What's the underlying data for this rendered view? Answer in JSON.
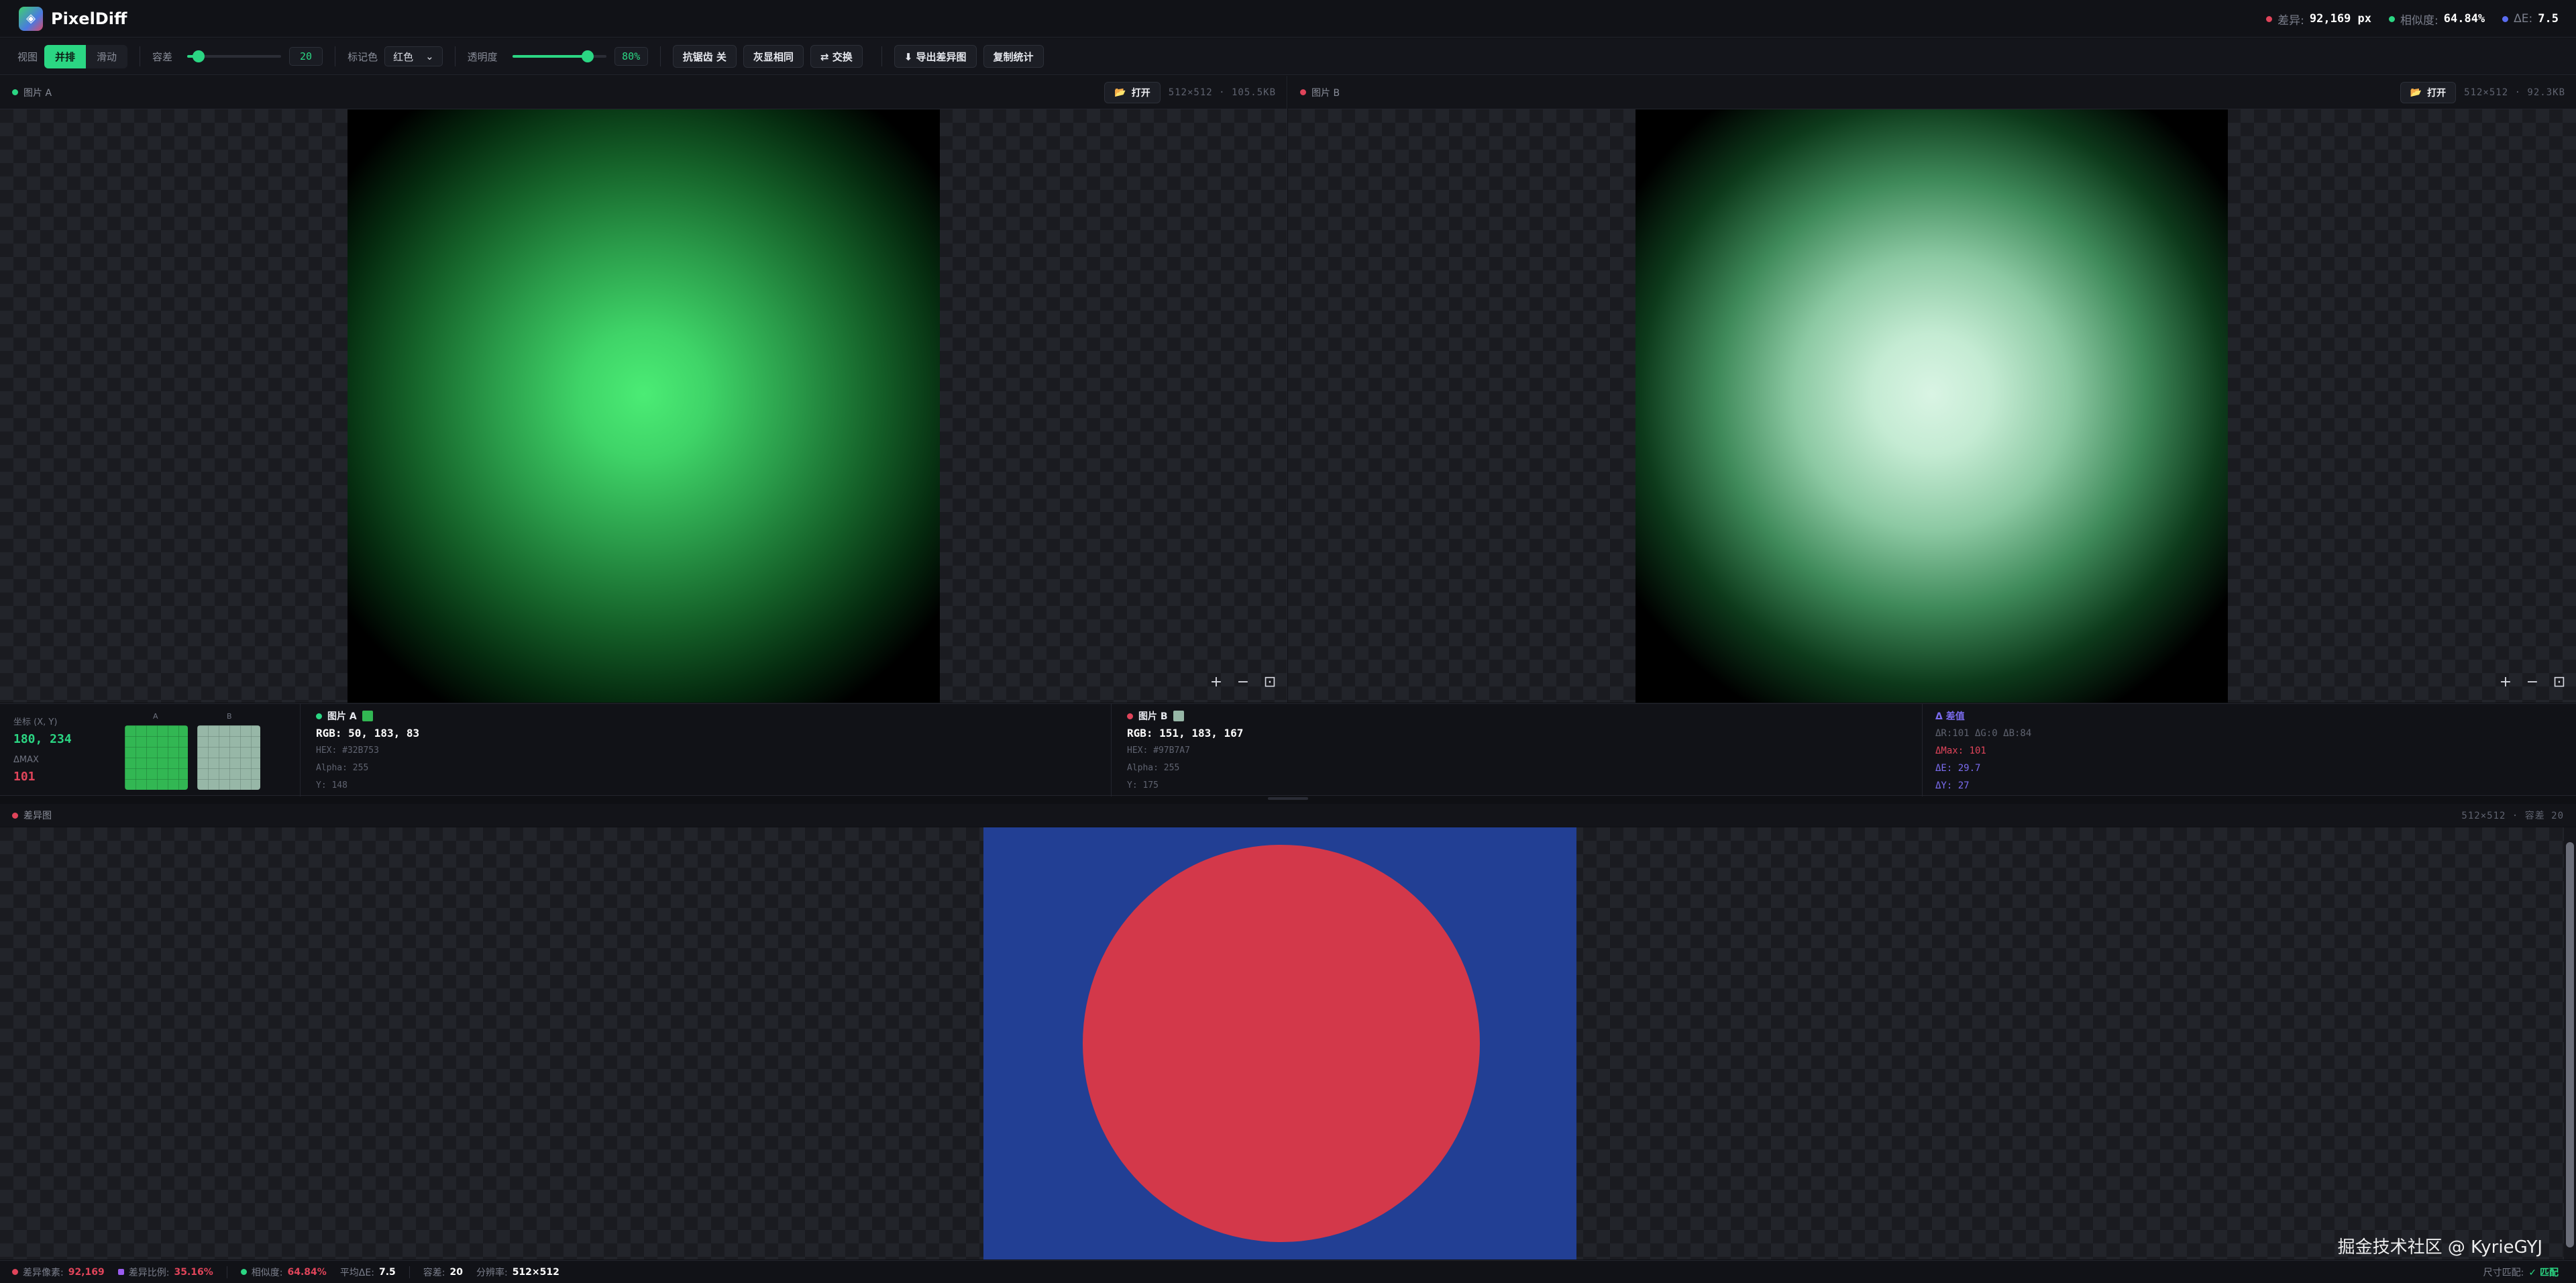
{
  "app": {
    "title": "PixelDiff"
  },
  "top_stats": [
    {
      "label": "差异:",
      "value": "92,169 px",
      "color": "#e0445a"
    },
    {
      "label": "相似度:",
      "value": "64.84%",
      "color": "#2bd683"
    },
    {
      "label": "ΔE:",
      "value": "7.5",
      "color": "#5a6cf0"
    }
  ],
  "toolbar": {
    "view_label": "视图",
    "mode_side": "并排",
    "mode_slide": "滑动",
    "tolerance_label": "容差",
    "tolerance_value": "20",
    "tolerance_level": 0.12,
    "marker_label": "标记色",
    "marker_value": "红色",
    "opacity_label": "透明度",
    "opacity_value": "80%",
    "opacity_level": 0.8,
    "antialias_btn": "抗锯齿 关",
    "gray_btn": "灰显相同",
    "swap_btn": "⇄ 交换",
    "export_btn": "⬇ 导出差异图",
    "copy_btn": "复制统计"
  },
  "panel_a": {
    "title": "图片 A",
    "open": "打开",
    "meta": "512×512 · 105.5KB",
    "dot": "#2bd683"
  },
  "panel_b": {
    "title": "图片 B",
    "open": "打开",
    "meta": "512×512 · 92.3KB",
    "dot": "#e0445a"
  },
  "zoom": {
    "in": "+",
    "out": "−",
    "fit": "⊡"
  },
  "probe": {
    "coord_label": "坐标 (X, Y)",
    "coord_value": "180, 234",
    "dmax_label": "ΔMAX",
    "dmax_value": "101",
    "loupe_a_label": "A",
    "loupe_b_label": "B"
  },
  "info_a": {
    "title": "图片 A",
    "color": "#32B753",
    "rgb": "RGB: 50, 183, 83",
    "hex": "HEX: #32B753",
    "alpha": "Alpha: 255",
    "y": "Y: 148"
  },
  "info_b": {
    "title": "图片 B",
    "color": "#97B7A7",
    "rgb": "RGB: 151, 183, 167",
    "hex": "HEX: #97B7A7",
    "alpha": "Alpha: 255",
    "y": "Y: 175"
  },
  "info_delta": {
    "title": "Δ 差值",
    "channels": "ΔR:101 ΔG:0 ΔB:84",
    "dmax": "ΔMax: 101",
    "de": "ΔE: 29.7",
    "dy": "ΔY: 27"
  },
  "diff": {
    "title": "差异图",
    "meta": "512×512 · 容差 20"
  },
  "watermark": "掘金技术社区 @ KyrieGYJ",
  "status": {
    "diff_pixels_label": "差异像素:",
    "diff_pixels_value": "92,169",
    "diff_ratio_label": "差异比例:",
    "diff_ratio_value": "35.16%",
    "similarity_label": "相似度:",
    "similarity_value": "64.84%",
    "avg_de_label": "平均ΔE:",
    "avg_de_value": "7.5",
    "tolerance_label": "容差:",
    "tolerance_value": "20",
    "resolution_label": "分辨率:",
    "resolution_value": "512×512",
    "size_match_label": "尺寸匹配:",
    "size_match_value": "✓ 匹配"
  }
}
